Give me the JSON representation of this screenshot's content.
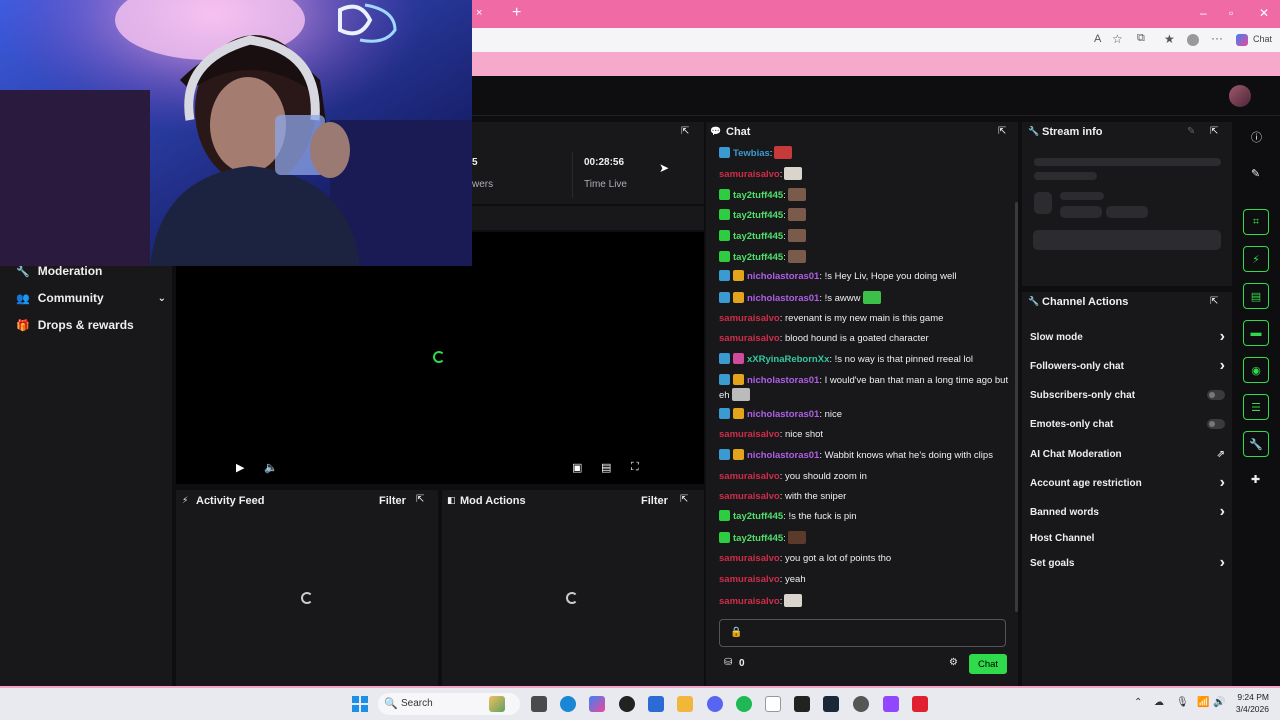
{
  "browser": {
    "tab_close": "×",
    "new_tab": "+",
    "profile_label": "Chat"
  },
  "left_nav": {
    "items": [
      {
        "label": "Moderation"
      },
      {
        "label": "Community"
      },
      {
        "label": "Drops & rewards"
      }
    ]
  },
  "stats": {
    "viewers_value": "5",
    "viewers_label": "wers",
    "time_value": "00:28:56",
    "time_label": "Time Live"
  },
  "activity_feed": {
    "title": "Activity Feed",
    "filter": "Filter"
  },
  "mod_actions": {
    "title": "Mod Actions",
    "filter": "Filter"
  },
  "chat": {
    "title": "Chat",
    "messages": [
      {
        "user": "Tewbias",
        "text": ":",
        "color": "#3b9bd1"
      },
      {
        "user": "samuraisalvo",
        "text": ":",
        "color": "#cf2d4a"
      },
      {
        "user": "tay2tuff445",
        "text": ":",
        "color": "#4ee06a"
      },
      {
        "user": "tay2tuff445",
        "text": ":",
        "color": "#4ee06a"
      },
      {
        "user": "tay2tuff445",
        "text": ":",
        "color": "#4ee06a"
      },
      {
        "user": "tay2tuff445",
        "text": ":",
        "color": "#4ee06a"
      },
      {
        "user": "nicholastoras01",
        "text": ": !s Hey Liv, Hope you doing well",
        "color": "#b05ee6"
      },
      {
        "user": "nicholastoras01",
        "text": ": !s awww",
        "color": "#b05ee6"
      },
      {
        "user": "samuraisalvo",
        "text": ": revenant is my new main is this game ",
        "color": "#cf2d4a"
      },
      {
        "user": "samuraisalvo",
        "text": ": blood hound is a goated character",
        "color": "#cf2d4a"
      },
      {
        "user": "xXRyinaRebornXx",
        "text": ": !s no way is that pinned rreeal lol",
        "color": "#35c9a0"
      },
      {
        "user": "nicholastoras01",
        "text": ": I would've ban that man a long time ago but",
        "color": "#b05ee6"
      },
      {
        "user": "",
        "text": "eh",
        "color": "#efeff1"
      },
      {
        "user": "nicholastoras01",
        "text": ": nice",
        "color": "#b05ee6"
      },
      {
        "user": "samuraisalvo",
        "text": ": nice shot",
        "color": "#cf2d4a"
      },
      {
        "user": "nicholastoras01",
        "text": ": Wabbit knows what he's doing with clips",
        "color": "#b05ee6"
      },
      {
        "user": "samuraisalvo",
        "text": ": you should zoom in",
        "color": "#cf2d4a"
      },
      {
        "user": "samuraisalvo",
        "text": ": with the sniper",
        "color": "#cf2d4a"
      },
      {
        "user": "tay2tuff445",
        "text": ": !s the fuck is pin",
        "color": "#4ee06a"
      },
      {
        "user": "tay2tuff445",
        "text": ":",
        "color": "#4ee06a"
      },
      {
        "user": "samuraisalvo",
        "text": ": you got a lot of points tho",
        "color": "#cf2d4a"
      },
      {
        "user": "samuraisalvo",
        "text": ": yeah",
        "color": "#cf2d4a"
      },
      {
        "user": "samuraisalvo",
        "text": ":",
        "color": "#cf2d4a"
      }
    ],
    "input_placeholder": "",
    "points": "0",
    "send_label": "Chat"
  },
  "stream_info": {
    "title": "Stream info"
  },
  "channel_actions": {
    "title": "Channel Actions",
    "items": [
      {
        "label": "Slow mode",
        "control": "arrow"
      },
      {
        "label": "Followers-only chat",
        "control": "arrow"
      },
      {
        "label": "Subscribers-only chat",
        "control": "toggle"
      },
      {
        "label": "Emotes-only chat",
        "control": "toggle"
      },
      {
        "label": "AI Chat Moderation",
        "control": "external"
      },
      {
        "label": "Account age restriction",
        "control": "arrow"
      },
      {
        "label": "Banned words",
        "control": "arrow"
      },
      {
        "label": "Host Channel",
        "control": "none"
      },
      {
        "label": "Set goals",
        "control": "arrow"
      }
    ]
  },
  "taskbar": {
    "search_label": "Search",
    "time": "9:24 PM",
    "date": "3/4/2026"
  },
  "colors": {
    "accent_green": "#2fdb4a",
    "twitch_bg": "#0e0e10",
    "panel_bg": "#18181b",
    "tab_pink": "#f06aa6"
  }
}
